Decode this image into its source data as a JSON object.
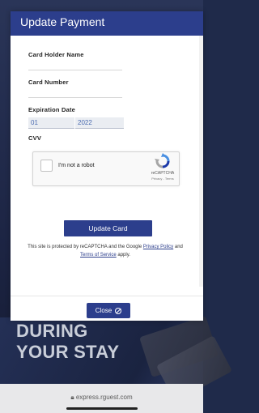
{
  "modal": {
    "title": "Update Payment",
    "fields": {
      "card_holder_label": "Card Holder Name",
      "card_number_label": "Card Number",
      "expiration_label": "Expiration Date",
      "exp_month": "01",
      "exp_year": "2022",
      "cvv_label": "CVV"
    },
    "recaptcha": {
      "label": "I'm not a robot",
      "brand": "reCAPTCHA",
      "links": "Privacy - Terms"
    },
    "update_button": "Update Card",
    "notice": {
      "prefix": "This site is protected by reCAPTCHA and the Google ",
      "privacy_link": "Privacy Policy",
      "middle": " and ",
      "terms_link": "Terms of Service",
      "suffix": " apply."
    },
    "close_button": "Close",
    "close_icon": "no-entry-icon"
  },
  "background": {
    "promo_line1": "DURING",
    "promo_line2": "YOUR STAY"
  },
  "browser": {
    "url": "express.rguest.com"
  },
  "colors": {
    "brand": "#2c3e8c",
    "background_dark": "#1f2a4a"
  }
}
